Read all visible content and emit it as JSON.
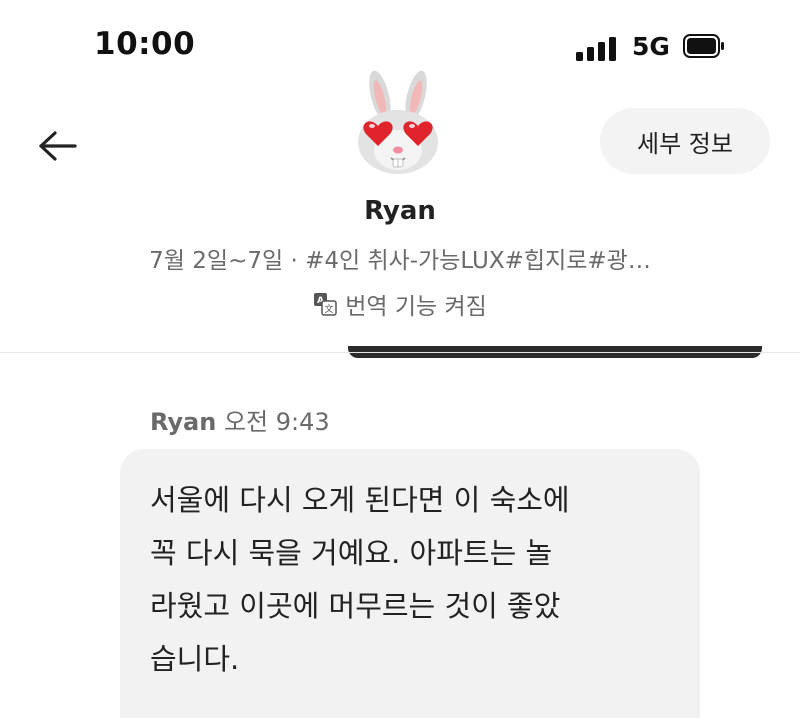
{
  "status_bar": {
    "time": "10:00",
    "network": "5G",
    "signal_icon": "signal-bars-icon",
    "battery_icon": "battery-full-icon"
  },
  "header": {
    "back_icon": "arrow-left-icon",
    "details_button": "세부 정보",
    "host_name": "Ryan",
    "avatar": "bunny-heart-eyes-emoji",
    "trip_summary": "7월 2일~7일 · #4인 취사-가능LUX#힙지로#광…",
    "translation_icon": "translate-icon",
    "translation_status": "번역 기능 켜짐"
  },
  "message": {
    "sender": "Ryan",
    "time": "오전 9:43",
    "text": "서울에 다시 오게 된다면 이 숙소에\n꼭 다시 묵을 거예요. 아파트는 놀\n라웠고 이곳에 머무르는 것이 좋았\n습니다."
  },
  "colors": {
    "background": "#ffffff",
    "bubble": "#f2f2f2",
    "secondary_text": "#6a6a6a",
    "primary_text": "#222222",
    "details_button_bg": "#f3f3f3"
  }
}
